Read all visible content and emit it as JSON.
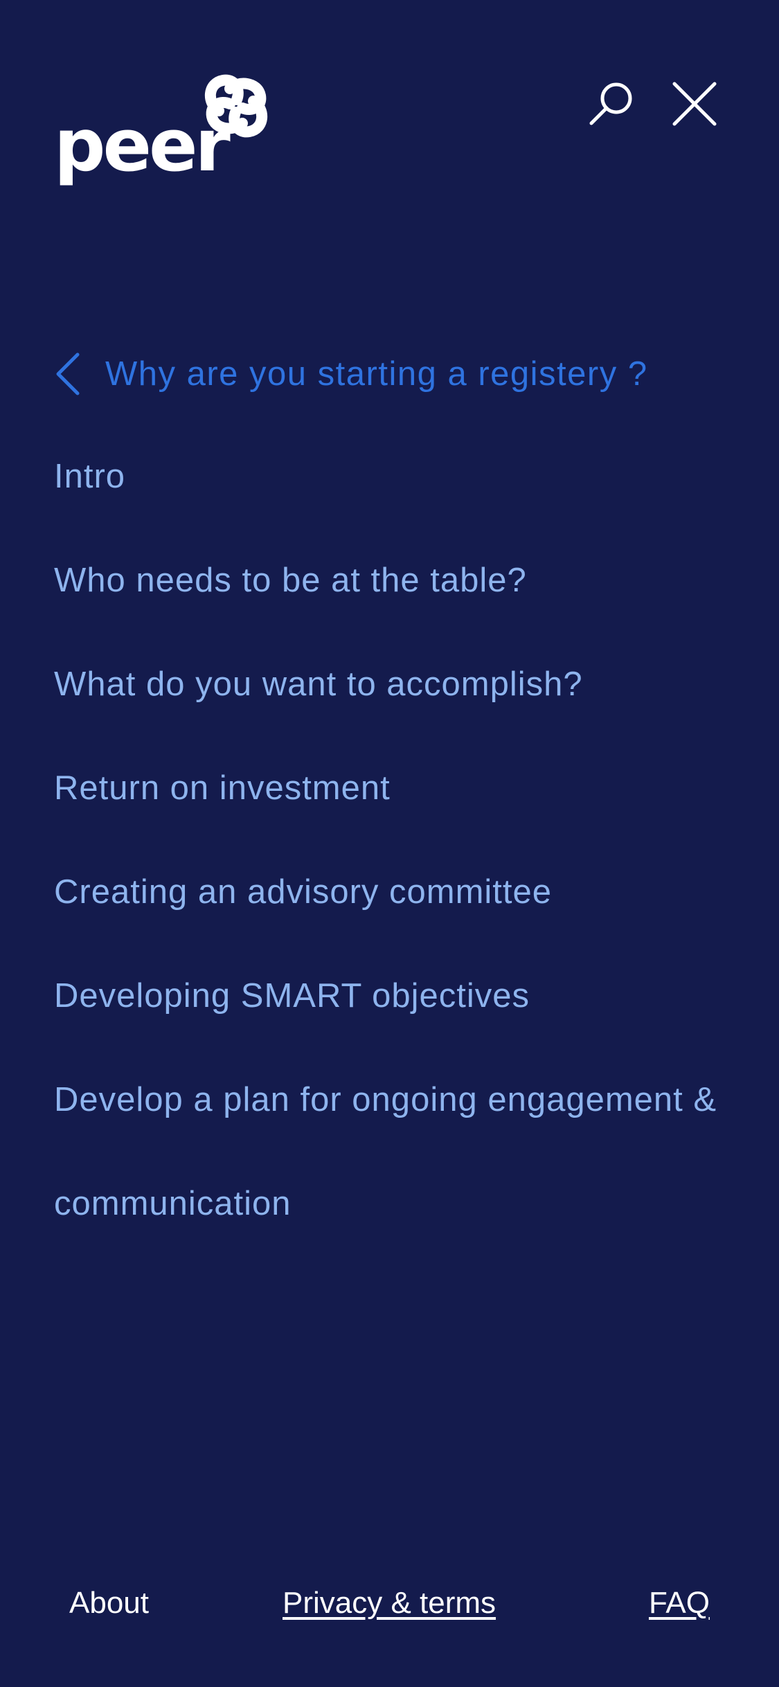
{
  "brand": {
    "name": "peer",
    "logo_icon": "knot-icon"
  },
  "header": {
    "search_icon": "search-icon",
    "close_icon": "close-icon"
  },
  "nav": {
    "back_label": "Why are you starting a registery ?",
    "back_icon": "chevron-left-icon",
    "items": [
      {
        "label": "Intro"
      },
      {
        "label": "Who needs to be at the table?"
      },
      {
        "label": "What do you want to accomplish?"
      },
      {
        "label": "Return on investment"
      },
      {
        "label": "Creating an advisory committee"
      },
      {
        "label": "Developing SMART objectives"
      },
      {
        "label": "Develop a plan for ongoing engagement & communication"
      }
    ]
  },
  "footer": {
    "about": "About",
    "privacy": "Privacy & terms",
    "faq": "FAQ"
  },
  "colors": {
    "background": "#141b4d",
    "accent": "#2f73e0",
    "menu_text": "#8eb4ee",
    "text": "#ffffff"
  }
}
